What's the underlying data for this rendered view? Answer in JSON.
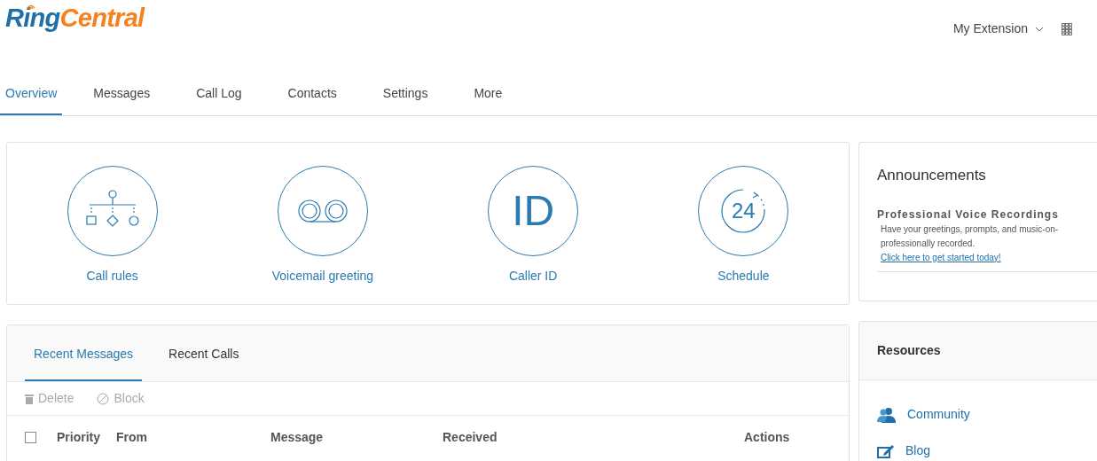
{
  "logo": {
    "part_1": "Ring",
    "part_2": "Central"
  },
  "account_menu": {
    "label": "My Extension"
  },
  "nav_tabs": [
    {
      "label": "Overview",
      "selected": true
    },
    {
      "label": "Messages",
      "selected": false
    },
    {
      "label": "Call Log",
      "selected": false
    },
    {
      "label": "Contacts",
      "selected": false
    },
    {
      "label": "Settings",
      "selected": false
    },
    {
      "label": "More",
      "selected": false
    }
  ],
  "shortcuts": [
    {
      "kind": "rules",
      "label": "Call rules"
    },
    {
      "kind": "voicemail",
      "label": "Voicemail greeting"
    },
    {
      "kind": "caller_id",
      "label": "Caller ID",
      "icon_text": "ID"
    },
    {
      "kind": "schedule",
      "label": "Schedule",
      "icon_text": "24"
    }
  ],
  "recent": {
    "tabs": [
      {
        "label": "Recent Messages",
        "selected": true
      },
      {
        "label": "Recent Calls",
        "selected": false
      }
    ],
    "actions": [
      {
        "kind": "delete",
        "label": "Delete",
        "disabled": true
      },
      {
        "kind": "block",
        "label": "Block",
        "disabled": true
      }
    ],
    "select_all": {
      "checked": false
    },
    "columns": [
      "Priority",
      "From",
      "Message",
      "Received",
      "Actions"
    ]
  },
  "announcements": {
    "title": "Announcements",
    "heading": "Professional Voice Recordings",
    "body": "Have your greetings, prompts, and music-on-",
    "body_2": "professionally recorded.",
    "link": "Click here to get started today!"
  },
  "resources": {
    "title": "Resources",
    "items": [
      {
        "kind": "community",
        "label": "Community"
      },
      {
        "kind": "blog",
        "label": "Blog"
      }
    ]
  }
}
